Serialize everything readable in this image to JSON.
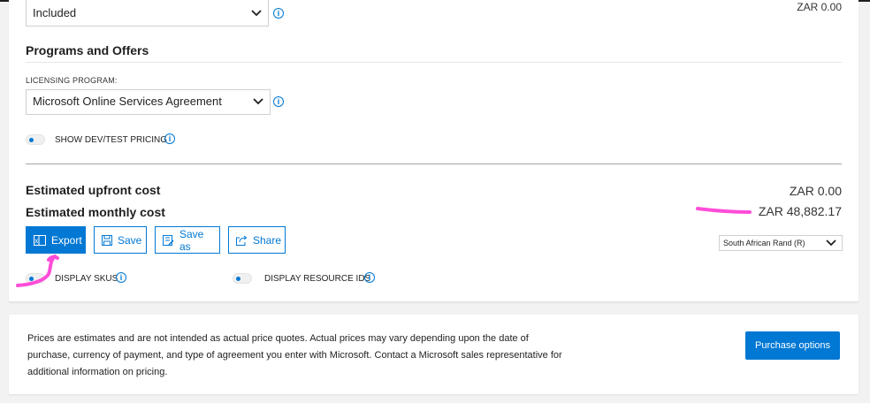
{
  "support_select": {
    "value": "Included"
  },
  "top_right_cost": "ZAR 0.00",
  "programs_section": {
    "heading": "Programs and Offers",
    "licensing_label": "LICENSING PROGRAM:",
    "licensing_value": "Microsoft Online Services Agreement",
    "devtest_label": "SHOW DEV/TEST PRICING"
  },
  "costs": {
    "upfront_label": "Estimated upfront cost",
    "upfront_value": "ZAR 0.00",
    "monthly_label": "Estimated monthly cost",
    "monthly_value": "ZAR 48,882.17"
  },
  "actions": {
    "export": "Export",
    "save": "Save",
    "save_as": "Save as",
    "share": "Share"
  },
  "currency": {
    "value": "South African Rand (R)"
  },
  "toggles": {
    "display_skus": "DISPLAY SKUS",
    "display_resource_ids": "DISPLAY RESOURCE IDS"
  },
  "footer": {
    "disclaimer": "Prices are estimates and are not intended as actual price quotes. Actual prices may vary depending upon the date of purchase, currency of payment, and type of agreement you enter with Microsoft. Contact a Microsoft sales representative for additional information on pricing.",
    "purchase_button": "Purchase options"
  },
  "colors": {
    "accent": "#0078d4",
    "annotation": "#ff4dd8"
  }
}
